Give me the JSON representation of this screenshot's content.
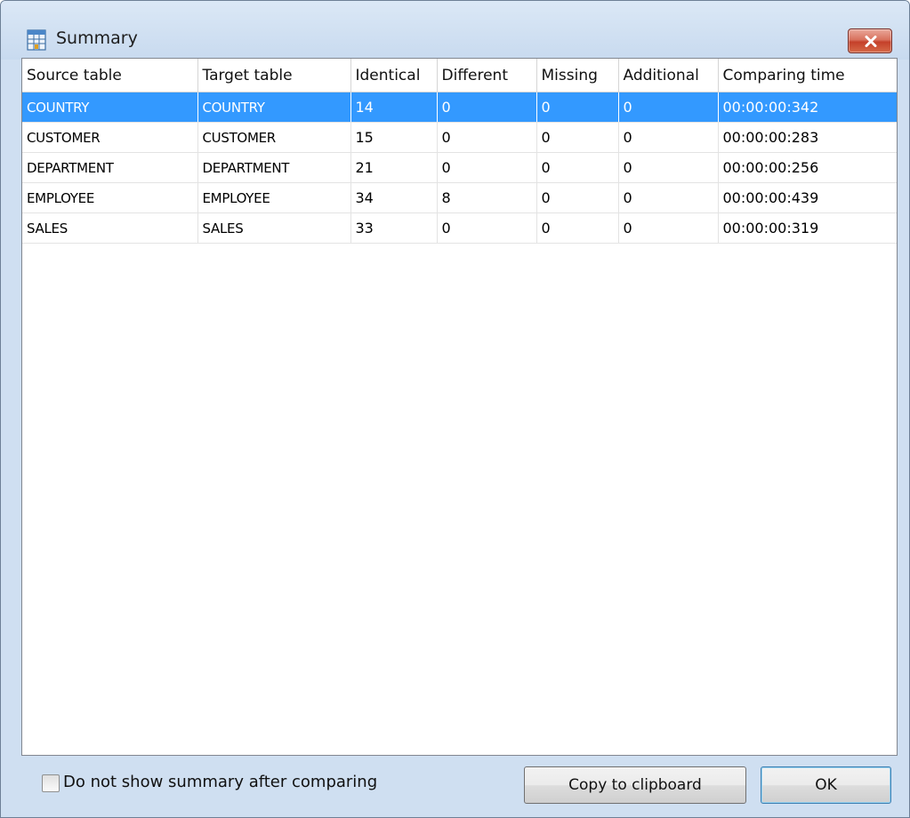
{
  "window": {
    "title": "Summary"
  },
  "table": {
    "columns": [
      "Source table",
      "Target table",
      "Identical",
      "Different",
      "Missing",
      "Additional",
      "Comparing time"
    ],
    "rows": [
      [
        "COUNTRY",
        "COUNTRY",
        "14",
        "0",
        "0",
        "0",
        "00:00:00:342"
      ],
      [
        "CUSTOMER",
        "CUSTOMER",
        "15",
        "0",
        "0",
        "0",
        "00:00:00:283"
      ],
      [
        "DEPARTMENT",
        "DEPARTMENT",
        "21",
        "0",
        "0",
        "0",
        "00:00:00:256"
      ],
      [
        "EMPLOYEE",
        "EMPLOYEE",
        "34",
        "8",
        "0",
        "0",
        "00:00:00:439"
      ],
      [
        "SALES",
        "SALES",
        "33",
        "0",
        "0",
        "0",
        "00:00:00:319"
      ]
    ],
    "selected_row": 0
  },
  "footer": {
    "checkbox_label": "Do not show summary after comparing",
    "checkbox_checked": false,
    "copy_button": "Copy to clipboard",
    "ok_button": "OK"
  },
  "colors": {
    "selection": "#3399ff",
    "close_button": "#c94a33",
    "frame": "#cfdff1"
  },
  "icons": {
    "title": "summary-table-icon",
    "close": "close-icon"
  }
}
